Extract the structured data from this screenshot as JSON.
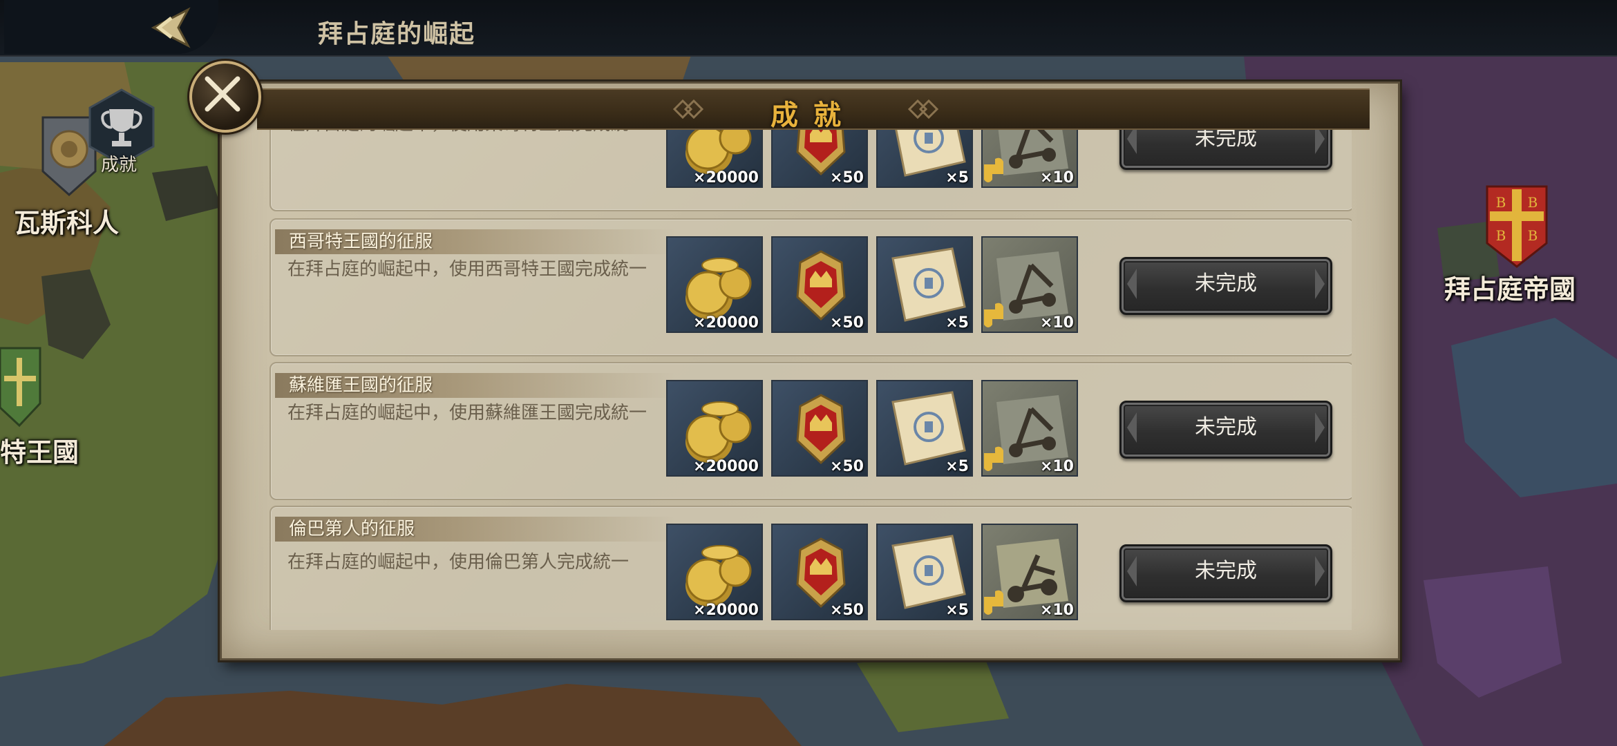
{
  "header": {
    "title": "拜占庭的崛起"
  },
  "map": {
    "labels": {
      "left_top": "瓦斯科人",
      "left_mid": "特王國",
      "right": "拜占庭帝國"
    },
    "achievements_shortcut": "成就"
  },
  "panel": {
    "title": "成就",
    "rows": [
      {
        "title": "",
        "desc": "在拜占庭的崛起中，使用東哥特王國完成統一",
        "rewards": [
          "×20000",
          "×50",
          "×5",
          "×10"
        ],
        "status": "未完成"
      },
      {
        "title": "西哥特王國的征服",
        "desc": "在拜占庭的崛起中，使用西哥特王國完成統一",
        "rewards": [
          "×20000",
          "×50",
          "×5",
          "×10"
        ],
        "status": "未完成"
      },
      {
        "title": "蘇維匯王國的征服",
        "desc": "在拜占庭的崛起中，使用蘇維匯王國完成統一",
        "rewards": [
          "×20000",
          "×50",
          "×5",
          "×10"
        ],
        "status": "未完成"
      },
      {
        "title": "倫巴第人的征服",
        "desc": "在拜占庭的崛起中，使用倫巴第人完成統一",
        "rewards": [
          "×20000",
          "×50",
          "×5",
          "×10"
        ],
        "status": "未完成"
      }
    ]
  },
  "icons": {
    "back": "back-arrow-icon",
    "close": "close-icon",
    "trophy": "trophy-icon",
    "reward_1": "gold-coins-icon",
    "reward_2": "crown-crest-icon",
    "reward_3": "scroll-icon",
    "reward_4": "catapult-puzzle-icon"
  },
  "colors": {
    "title_gold": "#e8b23c",
    "panel_parchment": "#c7bda5",
    "button_dark": "#2f2f2f"
  }
}
